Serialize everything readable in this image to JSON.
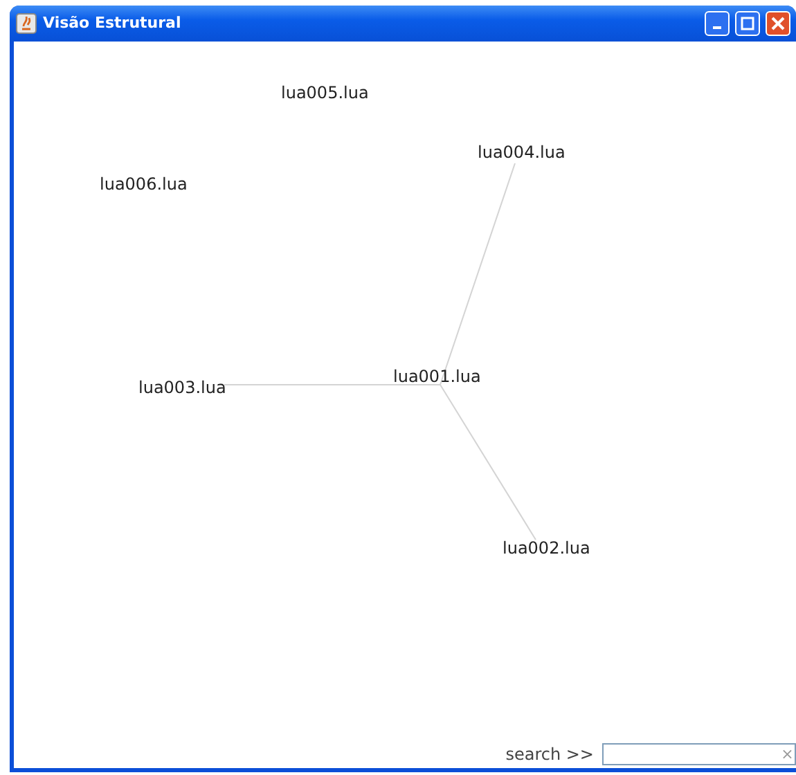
{
  "window": {
    "title": "Visão Estrutural"
  },
  "graph": {
    "nodes": [
      {
        "label": "lua005.lua"
      },
      {
        "label": "lua006.lua"
      },
      {
        "label": "lua001.lua",
        "children": [
          {
            "label": "lua004.lua"
          },
          {
            "label": "lua003.lua"
          },
          {
            "label": "lua002.lua"
          }
        ]
      }
    ]
  },
  "search": {
    "label": "search >>"
  }
}
